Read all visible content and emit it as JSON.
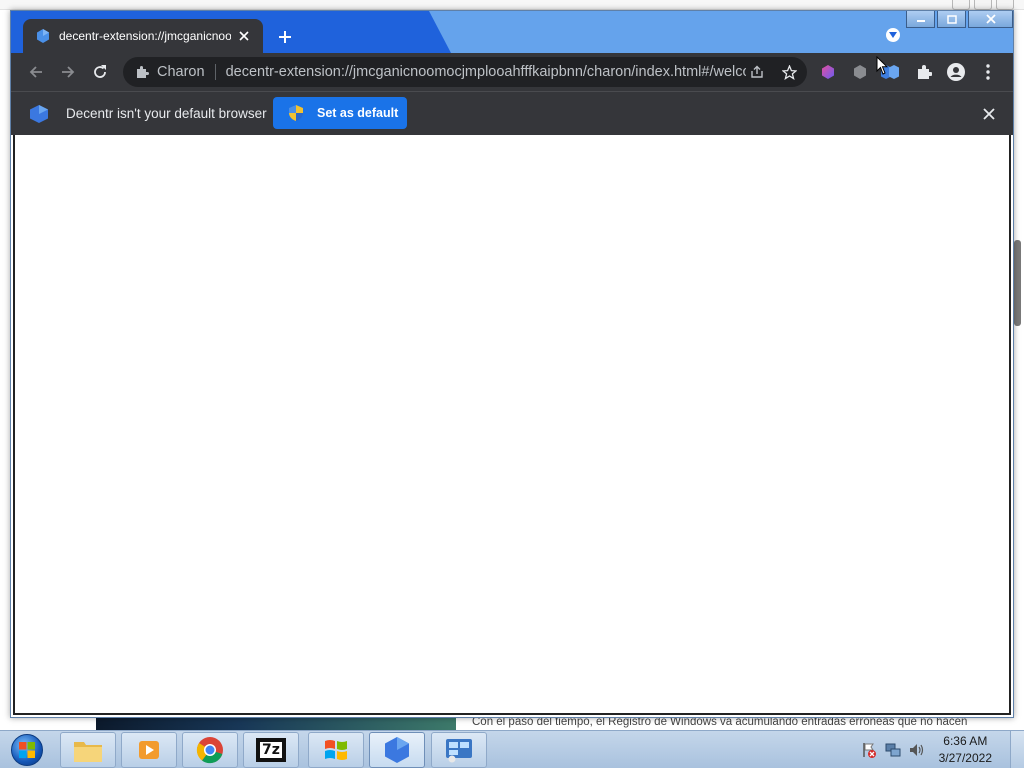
{
  "browser": {
    "tab": {
      "title": "decentr-extension://jmcganicnoomocjmplooahfffkaipbnn/charon/index.html#/welcome",
      "close_label": "×"
    },
    "new_tab_label": "+",
    "omnibox": {
      "chip": "Charon",
      "url": "decentr-extension://jmcganicnoomocjmplooahfffkaipbnn/charon/index.html#/welcome"
    },
    "infobar": {
      "message": "Decentr isn't your default browser",
      "button_label": "Set as default"
    }
  },
  "background": {
    "article_text": "Con el paso del tiempo, el Registro de Windows va acumulando entradas erróneas que no hacen"
  },
  "taskbar": {
    "apps": [
      {
        "name": "folder-app-icon"
      },
      {
        "name": "media-player-app-icon"
      },
      {
        "name": "chrome-app-icon"
      },
      {
        "name": "7zip-app-icon",
        "label": "7z"
      },
      {
        "name": "windows-app-icon"
      },
      {
        "name": "decentr-app-icon"
      },
      {
        "name": "control-panel-app-icon"
      }
    ],
    "clock_time": "6:36 AM",
    "clock_date": "3/27/2022"
  },
  "colors": {
    "accent": "#1a73e8",
    "toolbar": "#35363a",
    "titlebar": "#65a3ec",
    "tab_strip_dark": "#1f62dc"
  }
}
